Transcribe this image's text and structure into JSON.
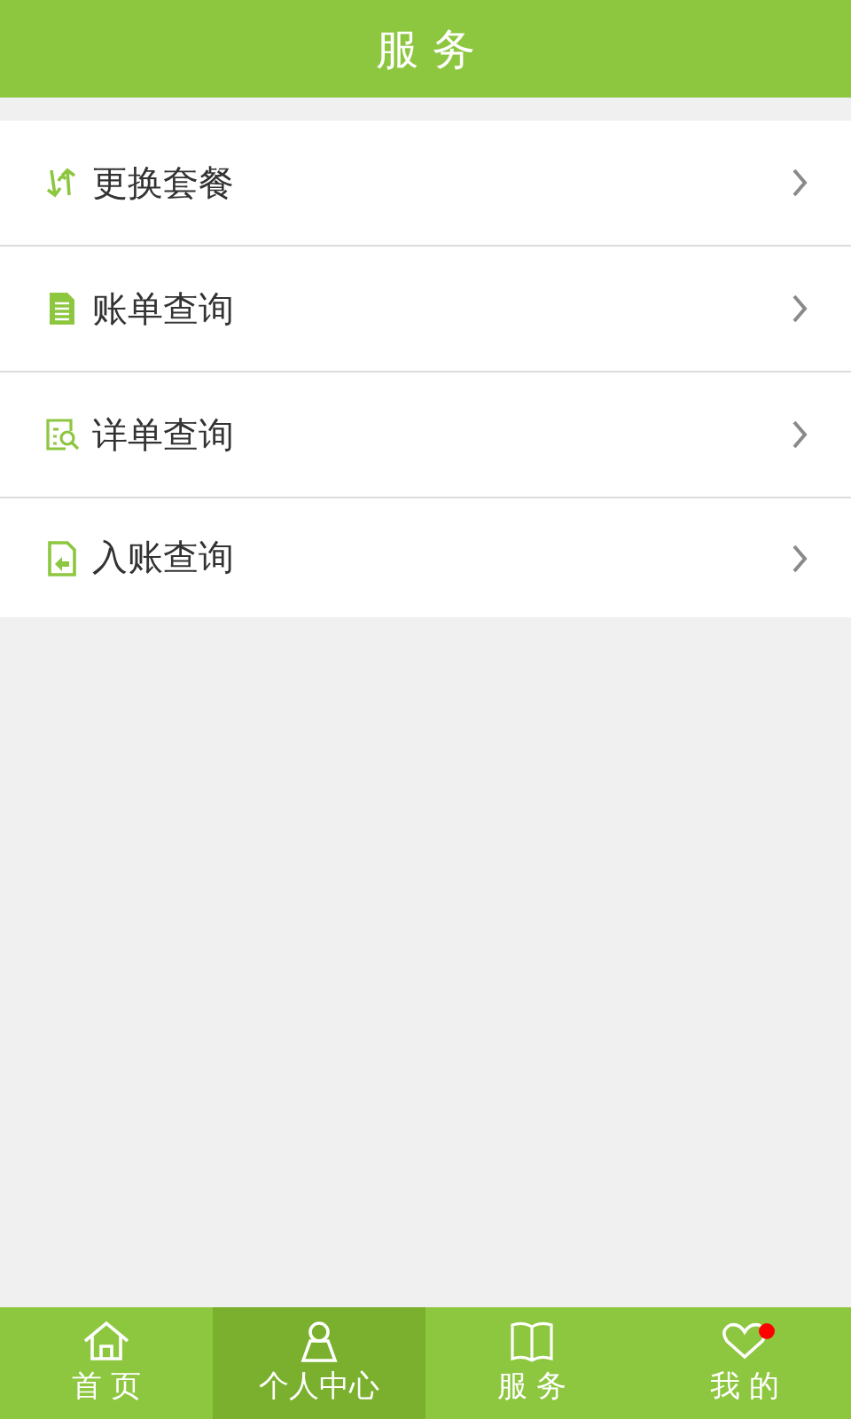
{
  "header": {
    "title": "服 务"
  },
  "menu": [
    {
      "label": "更换套餐"
    },
    {
      "label": "账单查询"
    },
    {
      "label": "详单查询"
    },
    {
      "label": "入账查询"
    }
  ],
  "tabs": [
    {
      "label": "首 页",
      "selected": false,
      "badge": false
    },
    {
      "label": "个人中心",
      "selected": true,
      "badge": false
    },
    {
      "label": "服 务",
      "selected": false,
      "badge": false
    },
    {
      "label": "我 的",
      "selected": false,
      "badge": true
    }
  ]
}
